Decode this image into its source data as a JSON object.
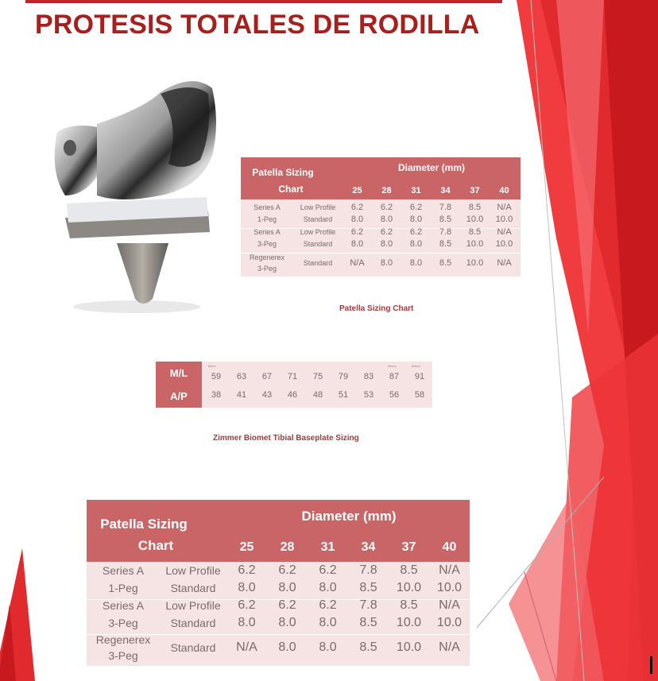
{
  "title": "PROTESIS TOTALES DE RODILLA",
  "patella_table": {
    "corner": [
      "Patella Sizing",
      "Chart"
    ],
    "diameter_label": "Diameter (mm)",
    "columns": [
      "25",
      "28",
      "31",
      "34",
      "37",
      "40"
    ],
    "rows": [
      {
        "group": "Series A",
        "type": "Low Profile",
        "values": [
          "6.2",
          "6.2",
          "6.2",
          "7.8",
          "8.5",
          "N/A"
        ]
      },
      {
        "group": "1-Peg",
        "type": "Standard",
        "values": [
          "8.0",
          "8.0",
          "8.0",
          "8.5",
          "10.0",
          "10.0"
        ]
      },
      {
        "group": "Series A",
        "type": "Low Profile",
        "values": [
          "6.2",
          "6.2",
          "6.2",
          "7.8",
          "8.5",
          "N/A"
        ]
      },
      {
        "group": "3-Peg",
        "type": "Standard",
        "values": [
          "8.0",
          "8.0",
          "8.0",
          "8.5",
          "10.0",
          "10.0"
        ]
      },
      {
        "group": "Regenerex",
        "group2": "3-Peg",
        "type": "Standard",
        "values": [
          "N/A",
          "8.0",
          "8.0",
          "8.5",
          "10.0",
          "N/A"
        ]
      }
    ]
  },
  "patella_caption": "Patella Sizing Chart",
  "baseplate_table": {
    "row_labels": [
      "M/L",
      "A/P"
    ],
    "ml_values": [
      "59",
      "63",
      "67",
      "71",
      "75",
      "79",
      "83",
      "87",
      "91"
    ],
    "ap_values": [
      "38",
      "41",
      "43",
      "46",
      "48",
      "51",
      "53",
      "56",
      "58"
    ],
    "small_marks": [
      "Micro",
      "Macro",
      "Macro"
    ]
  },
  "baseplate_caption": "Zimmer Biomet Tibial Baseplate Sizing",
  "colors": {
    "title": "#a8201e",
    "table_header": "#c96567",
    "table_body": "#f6e4e4",
    "accent_red": "#e8262b"
  }
}
